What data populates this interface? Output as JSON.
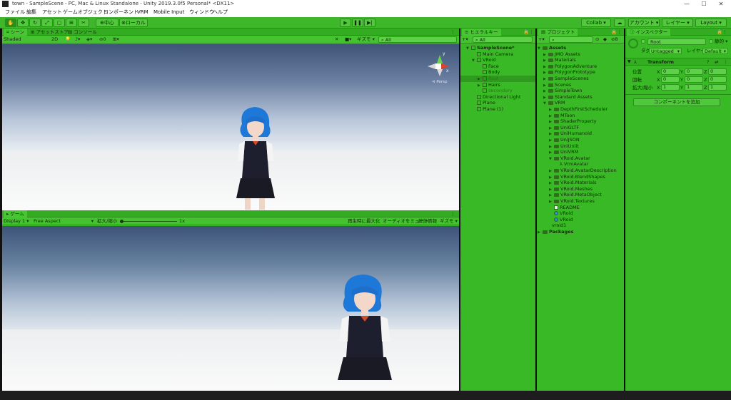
{
  "window": {
    "title": "town - SampleScene - PC, Mac & Linux Standalone - Unity 2019.3.0f5 Personal* <DX11>",
    "minimize": "—",
    "maximize": "☐",
    "close": "✕"
  },
  "menu": [
    "ファイル",
    "編集",
    "アセット",
    "ゲームオブジェクト",
    "コンポーネント",
    "VRM",
    "Mobile Input",
    "ウィンドウ",
    "ヘルプ"
  ],
  "toolbar": {
    "pivot_label": "中心",
    "local_label": "ローカル",
    "collab_label": "Collab",
    "account_label": "アカウント",
    "layers_label": "レイヤー",
    "layout_label": "Layout"
  },
  "scene": {
    "tabs": [
      "シーン",
      "アセットストア",
      "コンソール"
    ],
    "shading_mode": "Shaded",
    "mode_2d": "2D",
    "fx_count": "0",
    "gizmos_label": "ギズモ",
    "search_placeholder": "All",
    "persp_label": "Persp",
    "axis_y": "y",
    "axis_x": "x"
  },
  "game": {
    "tab": "ゲーム",
    "display": "Display 1",
    "aspect": "Free Aspect",
    "scale_label": "拡大/縮小",
    "scale_value": "1x",
    "maximize_on_play": "再生時に最大化",
    "mute_audio": "オーディオをミュート",
    "stats": "統計情報",
    "gizmos": "ギズモ"
  },
  "hierarchy": {
    "tab": "ヒエラルキー",
    "search_placeholder": "All",
    "items": [
      {
        "label": "SampleScene*",
        "depth": 0,
        "bold": true,
        "fold": "▼"
      },
      {
        "label": "Main Camera",
        "depth": 1
      },
      {
        "label": "VRoid",
        "depth": 1,
        "fold": "▼"
      },
      {
        "label": "Face",
        "depth": 2
      },
      {
        "label": "Body",
        "depth": 2
      },
      {
        "label": "Root",
        "depth": 2,
        "fold": "▶",
        "selected": true,
        "faded": true
      },
      {
        "label": "Hairs",
        "depth": 2,
        "fold": "▶"
      },
      {
        "label": "secondary",
        "depth": 2,
        "faded": true
      },
      {
        "label": "Directional Light",
        "depth": 1
      },
      {
        "label": "Plane",
        "depth": 1
      },
      {
        "label": "Plane (1)",
        "depth": 1
      }
    ]
  },
  "project": {
    "tab": "プロジェクト",
    "hidden_count": "8",
    "items": [
      {
        "label": "Assets",
        "depth": 0,
        "fold": "▼",
        "bold": true
      },
      {
        "label": "JMO Assets",
        "depth": 1,
        "fold": "▶"
      },
      {
        "label": "Materials",
        "depth": 1,
        "fold": "▶"
      },
      {
        "label": "PolygonAdventure",
        "depth": 1,
        "fold": "▶"
      },
      {
        "label": "PolygonPrototype",
        "depth": 1,
        "fold": "▶"
      },
      {
        "label": "SampleScenes",
        "depth": 1,
        "fold": "▶"
      },
      {
        "label": "Scenes",
        "depth": 1,
        "fold": "▶"
      },
      {
        "label": "SimpleTown",
        "depth": 1,
        "fold": "▶"
      },
      {
        "label": "Standard Assets",
        "depth": 1,
        "fold": "▶"
      },
      {
        "label": "VRM",
        "depth": 1,
        "fold": "▼"
      },
      {
        "label": "DepthFirstScheduler",
        "depth": 2,
        "fold": "▶"
      },
      {
        "label": "MToon",
        "depth": 2,
        "fold": "▶"
      },
      {
        "label": "ShaderProperty",
        "depth": 2,
        "fold": "▶"
      },
      {
        "label": "UniGLTF",
        "depth": 2,
        "fold": "▶"
      },
      {
        "label": "UniHumanoid",
        "depth": 2,
        "fold": "▶"
      },
      {
        "label": "UniJSON",
        "depth": 2,
        "fold": "▶"
      },
      {
        "label": "UniUnlit",
        "depth": 2,
        "fold": "▶"
      },
      {
        "label": "UniVRM",
        "depth": 2,
        "fold": "▶"
      },
      {
        "label": "VRoid.Avatar",
        "depth": 2,
        "fold": "▼"
      },
      {
        "label": "VrmAvatar",
        "depth": 3,
        "icon": "avatar"
      },
      {
        "label": "VRoid.AvatarDescription",
        "depth": 2,
        "fold": "▶"
      },
      {
        "label": "VRoid.BlendShapes",
        "depth": 2,
        "fold": "▶"
      },
      {
        "label": "VRoid.Materials",
        "depth": 2,
        "fold": "▶"
      },
      {
        "label": "VRoid.Meshes",
        "depth": 2,
        "fold": "▶"
      },
      {
        "label": "VRoid.MetaObject",
        "depth": 2,
        "fold": "▶"
      },
      {
        "label": "VRoid.Textures",
        "depth": 2,
        "fold": "▶"
      },
      {
        "label": "README",
        "depth": 2,
        "icon": "doc"
      },
      {
        "label": "VRoid",
        "depth": 2,
        "icon": "prefab"
      },
      {
        "label": "VRoid",
        "depth": 2,
        "icon": "prefab"
      },
      {
        "label": "vroid1",
        "depth": 1,
        "icon": "vrm"
      },
      {
        "label": "Packages",
        "depth": 0,
        "fold": "▶",
        "bold": true
      }
    ]
  },
  "inspector": {
    "tab": "インスペクター",
    "object_name": "Root",
    "static_label": "静的",
    "tag_label": "タグ",
    "tag_value": "Untagged",
    "layer_label": "レイヤー",
    "layer_value": "Default",
    "transform_title": "Transform",
    "rows": [
      {
        "label": "位置",
        "x": "0",
        "y": "0",
        "z": "0"
      },
      {
        "label": "回転",
        "x": "0",
        "y": "0",
        "z": "0"
      },
      {
        "label": "拡大/縮小",
        "x": "1",
        "y": "1",
        "z": "1"
      }
    ],
    "add_component": "コンポーネントを追加"
  },
  "colors": {
    "panel": "#39b925",
    "toolbar": "#3eb82a",
    "tab_active": "#48c533",
    "selection": "#2e9a1e"
  }
}
